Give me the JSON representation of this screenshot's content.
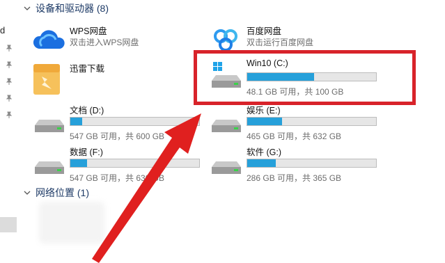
{
  "left_pane": {
    "fragment_text": "d"
  },
  "devices_section": {
    "title": "设备和驱动器 (8)"
  },
  "network_section": {
    "title": "网络位置 (1)"
  },
  "apps": [
    {
      "name": "WPS网盘",
      "desc": "双击进入WPS网盘",
      "icon": "wps-cloud-icon"
    },
    {
      "name": "百度网盘",
      "desc": "双击运行百度网盘",
      "icon": "baidu-netdisk-icon"
    },
    {
      "name": "迅雷下载",
      "desc": "",
      "icon": "thunder-folder-icon"
    }
  ],
  "drives": [
    {
      "name": "Win10 (C:)",
      "space": "48.1 GB 可用，共 100 GB",
      "used_fraction": 0.52,
      "icon": "windows-drive-icon"
    },
    {
      "name": "文档 (D:)",
      "space": "547 GB 可用，共 600 GB",
      "used_fraction": 0.09,
      "icon": "drive-icon"
    },
    {
      "name": "娱乐 (E:)",
      "space": "465 GB 可用，共 632 GB",
      "used_fraction": 0.27,
      "icon": "drive-icon"
    },
    {
      "name": "数据 (F:)",
      "space": "547 GB 可用，共 630 GB",
      "used_fraction": 0.13,
      "icon": "drive-icon"
    },
    {
      "name": "软件 (G:)",
      "space": "286 GB 可用，共 365 GB",
      "used_fraction": 0.22,
      "icon": "drive-icon"
    }
  ],
  "colors": {
    "highlight": "#d8232a",
    "bar_fill": "#26a0da",
    "bar_bg": "#e6e6e6",
    "arrow": "#e0201f"
  }
}
